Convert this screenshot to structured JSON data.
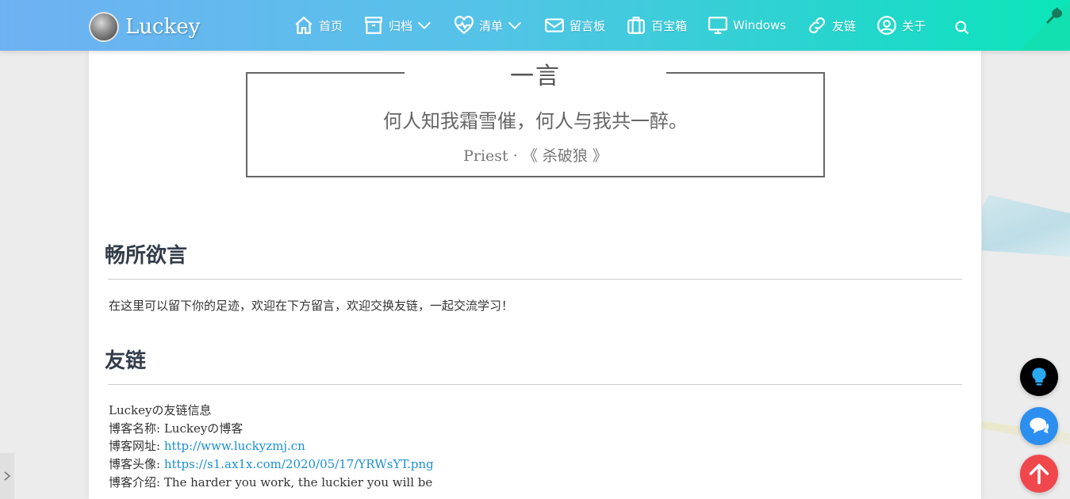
{
  "brand": {
    "name": "Luckey"
  },
  "nav": [
    {
      "label": "首页",
      "icon": "home-icon"
    },
    {
      "label": "归档",
      "icon": "archive-icon",
      "dropdown": true
    },
    {
      "label": "清单",
      "icon": "heartbeat-icon",
      "dropdown": true
    },
    {
      "label": "留言板",
      "icon": "envelope-icon"
    },
    {
      "label": "百宝箱",
      "icon": "suitcase-icon"
    },
    {
      "label": "Windows",
      "icon": "desktop-icon"
    },
    {
      "label": "友链",
      "icon": "link-icon"
    },
    {
      "label": "关于",
      "icon": "user-circle-icon"
    }
  ],
  "quote": {
    "title": "一言",
    "text": "何人知我霜雪催，何人与我共一醉。",
    "author": "Priest · 《 杀破狼 》"
  },
  "section1": {
    "title": "畅所欲言",
    "text": "在这里可以留下你的足迹，欢迎在下方留言，欢迎交换友链，一起交流学习！"
  },
  "section2": {
    "title": "友链",
    "heading": "Luckeyの友链信息",
    "name_label": "博客名称: ",
    "name_value": "Luckeyの博客",
    "url_label": "博客网址: ",
    "url_value": "http://www.luckyzmj.cn",
    "avatar_label": "博客头像: ",
    "avatar_value": "https://s1.ax1x.com/2020/05/17/YRWsYT.png",
    "intro_label": "博客介绍: ",
    "intro_value": "The harder you work, the luckier you will be"
  },
  "colors": {
    "header_start": "#6fb1f3",
    "header_end": "#0be6b8",
    "link": "#1c8fd0",
    "fab_idea": "#000000",
    "fab_chat": "#2c8ff0",
    "fab_top": "#f0474d"
  }
}
